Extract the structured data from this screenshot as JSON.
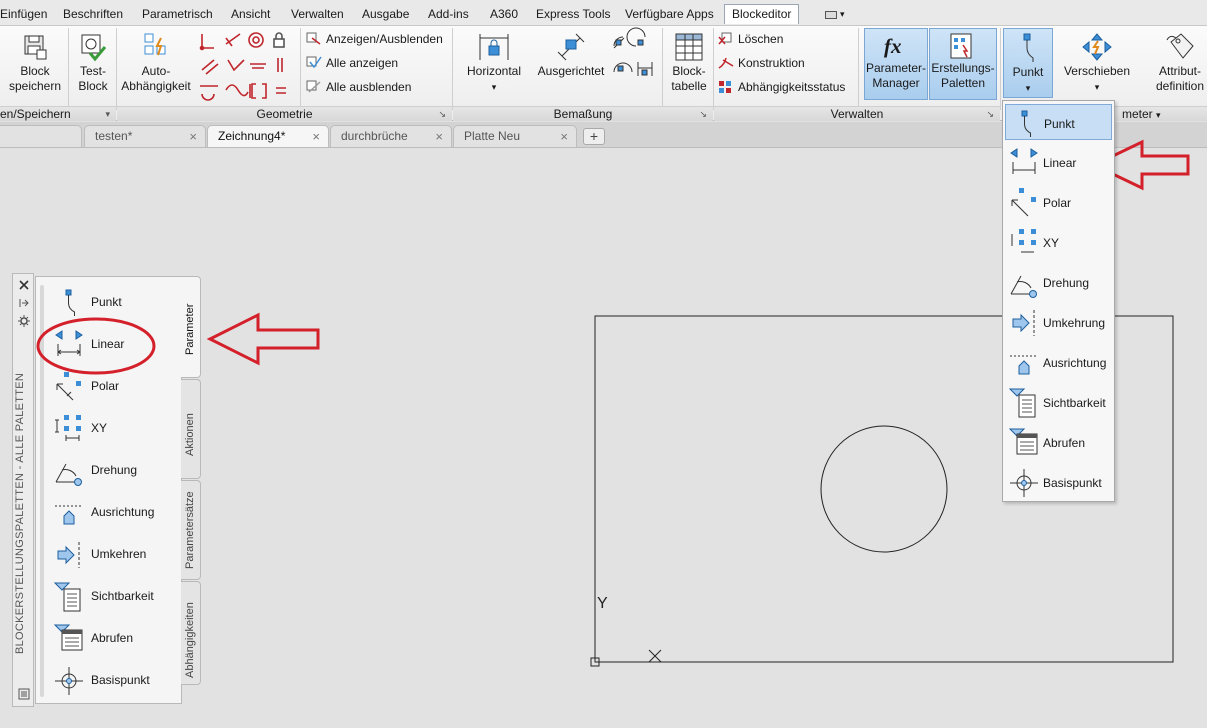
{
  "menu": {
    "items": [
      "Einfügen",
      "Beschriften",
      "Parametrisch",
      "Ansicht",
      "Verwalten",
      "Ausgabe",
      "Add-ins",
      "A360",
      "Express Tools",
      "Verfügbare Apps",
      "Blockeditor"
    ],
    "active": "Blockeditor"
  },
  "ribbon": {
    "block_save": {
      "line1": "Block",
      "line2": "speichern"
    },
    "test_block": {
      "line1": "Test-",
      "line2": "Block"
    },
    "auto_constrain": {
      "line1": "Auto-",
      "line2": "Abhängigkeit"
    },
    "show_hide": "Anzeigen/Ausblenden",
    "show_all": "Alle anzeigen",
    "hide_all": "Alle ausblenden",
    "horizontal": "Horizontal",
    "aligned": "Ausgerichtet",
    "block_table": {
      "line1": "Block-",
      "line2": "tabelle"
    },
    "delete": "Löschen",
    "construction": "Konstruktion",
    "constraint_status": "Abhängigkeitsstatus",
    "param_manager": {
      "line1": "Parameter-",
      "line2": "Manager"
    },
    "authoring_palettes": {
      "line1": "Erstellungs-",
      "line2": "Paletten"
    },
    "point": "Punkt",
    "move": "Verschieben",
    "attrib_def": {
      "line1": "Attribut-",
      "line2": "definition"
    },
    "panels": {
      "open_save": "en/Speichern",
      "geometry": "Geometrie",
      "dimension": "Bemaßung",
      "manage": "Verwalten",
      "parameter_trunc": "meter"
    }
  },
  "tabs": [
    {
      "label": "testen*",
      "active": false
    },
    {
      "label": "Zeichnung4*",
      "active": true
    },
    {
      "label": "durchbrüche",
      "active": false
    },
    {
      "label": "Platte Neu",
      "active": false
    }
  ],
  "tab_close_glyph": "×",
  "new_tab_glyph": "+",
  "palette": {
    "title": "BLOCKERSTELLUNGSPALETTEN - ALLE PALETTEN",
    "items": [
      "Punkt",
      "Linear",
      "Polar",
      "XY",
      "Drehung",
      "Ausrichtung",
      "Umkehren",
      "Sichtbarkeit",
      "Abrufen",
      "Basispunkt"
    ],
    "tabs": [
      "Parameter",
      "Aktionen",
      "Parametersätze",
      "Abhängigkeiten"
    ]
  },
  "dropdown": {
    "items": [
      "Punkt",
      "Linear",
      "Polar",
      "XY",
      "Drehung",
      "Umkehrung",
      "Ausrichtung",
      "Sichtbarkeit",
      "Abrufen",
      "Basispunkt"
    ],
    "selected": "Punkt"
  },
  "ucs": {
    "y_label": "Y"
  },
  "colors": {
    "accent_red": "#d4202a",
    "icon_blue": "#3c8ed6"
  }
}
